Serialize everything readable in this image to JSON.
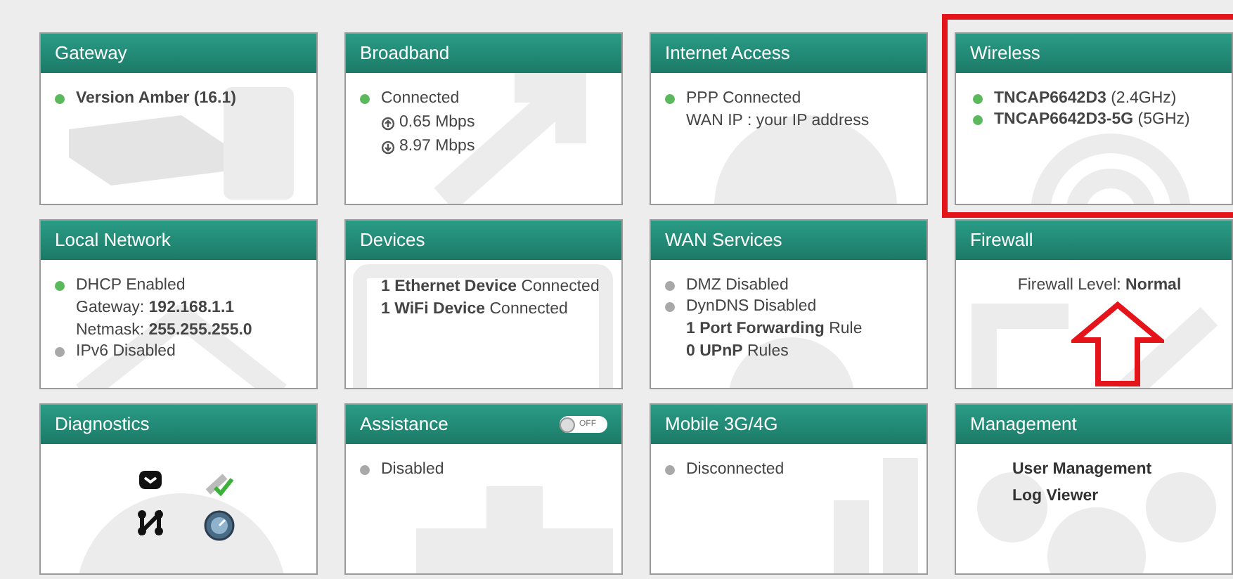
{
  "tiles": [
    {
      "title": "Gateway",
      "lines": [
        {
          "kind": "status",
          "text": "**Version Amber (16.1)**",
          "color": "#5cb85c"
        }
      ]
    },
    {
      "title": "Broadband",
      "lines": [
        {
          "kind": "status",
          "text": "Connected",
          "color": "#5cb85c"
        },
        {
          "kind": "upload",
          "text": "0.65 Mbps"
        },
        {
          "kind": "download",
          "text": "8.97 Mbps"
        }
      ]
    },
    {
      "title": "Internet Access",
      "lines": [
        {
          "kind": "status",
          "text": "PPP Connected",
          "color": "#5cb85c"
        },
        {
          "kind": "detail",
          "text": "WAN IP :  your IP address"
        }
      ]
    },
    {
      "title": "Wireless",
      "highlighted": true,
      "lines": [
        {
          "kind": "status",
          "text": "**TNCAP6642D3** (2.4GHz)",
          "color": "#5cb85c"
        },
        {
          "kind": "status",
          "text": "**TNCAP6642D3-5G** (5GHz)",
          "color": "#5cb85c"
        }
      ]
    },
    {
      "title": "Local Network",
      "lines": [
        {
          "kind": "status",
          "text": "DHCP Enabled",
          "color": "#5cb85c"
        },
        {
          "kind": "detail",
          "text": "Gateway: **192.168.1.1**"
        },
        {
          "kind": "detail",
          "text": "Netmask: **255.255.255.0**"
        },
        {
          "kind": "status",
          "text": "IPv6 Disabled",
          "color": "#a8a8a8"
        }
      ]
    },
    {
      "title": "Devices",
      "lines": [
        {
          "kind": "detail",
          "text": "**1 Ethernet Device** Connected"
        },
        {
          "kind": "detail",
          "text": "**1 WiFi Device** Connected"
        }
      ]
    },
    {
      "title": "WAN Services",
      "lines": [
        {
          "kind": "status",
          "text": "DMZ Disabled",
          "color": "#a8a8a8"
        },
        {
          "kind": "status",
          "text": "DynDNS Disabled",
          "color": "#a8a8a8"
        },
        {
          "kind": "detail",
          "text": "**1 Port Forwarding** Rule"
        },
        {
          "kind": "detail",
          "text": "**0 UPnP** Rules"
        }
      ]
    },
    {
      "title": "Firewall",
      "lines": [
        {
          "kind": "centered",
          "text": "Firewall Level: **Normal**"
        }
      ]
    },
    {
      "title": "Diagnostics",
      "lines": [
        {
          "kind": "diagnostic-icons"
        }
      ]
    },
    {
      "title": "Assistance",
      "toggle": {
        "label": "OFF",
        "on": false
      },
      "lines": [
        {
          "kind": "status",
          "text": "Disabled",
          "color": "#a8a8a8"
        }
      ]
    },
    {
      "title": "Mobile 3G/4G",
      "lines": [
        {
          "kind": "status",
          "text": "Disconnected",
          "color": "#a8a8a8"
        }
      ]
    },
    {
      "title": "Management",
      "lines": [
        {
          "kind": "link",
          "text": "User Management"
        },
        {
          "kind": "link",
          "text": "Log Viewer"
        }
      ]
    }
  ]
}
